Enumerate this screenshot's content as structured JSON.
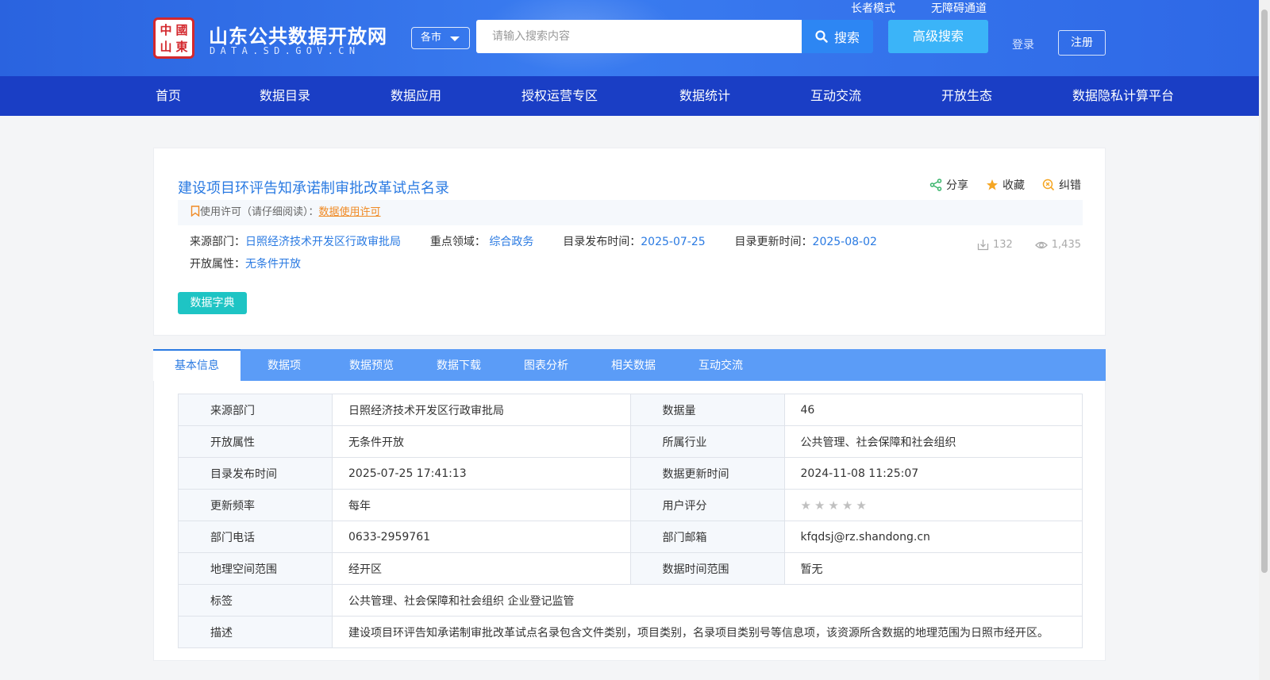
{
  "header": {
    "seal_chars": [
      "中",
      "國",
      "山",
      "東"
    ],
    "site_title": "山东公共数据开放网",
    "site_subtitle": "DATA.SD.GOV.CN",
    "city_select": "各市",
    "search_placeholder": "请输入搜索内容",
    "search_button": "搜索",
    "advanced_search": "高级搜索",
    "elder_mode": "长者模式",
    "accessibility": "无障碍通道",
    "login": "登录",
    "register": "注册"
  },
  "nav": {
    "items": [
      "首页",
      "数据目录",
      "数据应用",
      "授权运营专区",
      "数据统计",
      "互动交流",
      "开放生态",
      "数据隐私计算平台"
    ]
  },
  "dataset": {
    "title": "建设项目环评告知承诺制审批改革试点名录",
    "actions": {
      "share": "分享",
      "favorite": "收藏",
      "correct": "纠错"
    },
    "license_label": "使用许可（请仔细阅读）：",
    "license_link": "数据使用许可",
    "meta": {
      "source_label": "来源部门：",
      "source_value": "日照经济技术开发区行政审批局",
      "domain_label": "重点领域：",
      "domain_value": "综合政务",
      "publish_label": "目录发布时间：",
      "publish_value": "2025-07-25",
      "update_label": "目录更新时间：",
      "update_value": "2025-08-02",
      "open_label": "开放属性：",
      "open_value": "无条件开放"
    },
    "stats": {
      "downloads": "132",
      "views": "1,435"
    },
    "dict_button": "数据字典"
  },
  "tabs": [
    "基本信息",
    "数据项",
    "数据预览",
    "数据下载",
    "图表分析",
    "相关数据",
    "互动交流"
  ],
  "info_table": {
    "rows": [
      [
        "来源部门",
        "日照经济技术开发区行政审批局",
        "数据量",
        "46"
      ],
      [
        "开放属性",
        "无条件开放",
        "所属行业",
        "公共管理、社会保障和社会组织"
      ],
      [
        "目录发布时间",
        "2025-07-25 17:41:13",
        "数据更新时间",
        "2024-11-08 11:25:07"
      ],
      [
        "更新频率",
        "每年",
        "用户评分",
        ""
      ],
      [
        "部门电话",
        "0633-2959761",
        "部门邮箱",
        "kfqdsj@rz.shandong.cn"
      ],
      [
        "地理空间范围",
        "经开区",
        "数据时间范围",
        "暂无"
      ]
    ],
    "tags_label": "标签",
    "tags_value": "公共管理、社会保障和社会组织  企业登记监管",
    "desc_label": "描述",
    "desc_value": "建设项目环评告知承诺制审批改革试点名录包含文件类别，项目类别，名录项目类别号等信息项，该资源所含数据的地理范围为日照市经开区。",
    "rating": 0
  },
  "colors": {
    "header_blue": "#2a63df",
    "nav_blue": "#1a3ec5",
    "link_blue": "#2a7ae2",
    "tab_blue": "#5b9cf7",
    "dict_teal": "#1ec4c4",
    "license_orange": "#f08a24"
  }
}
